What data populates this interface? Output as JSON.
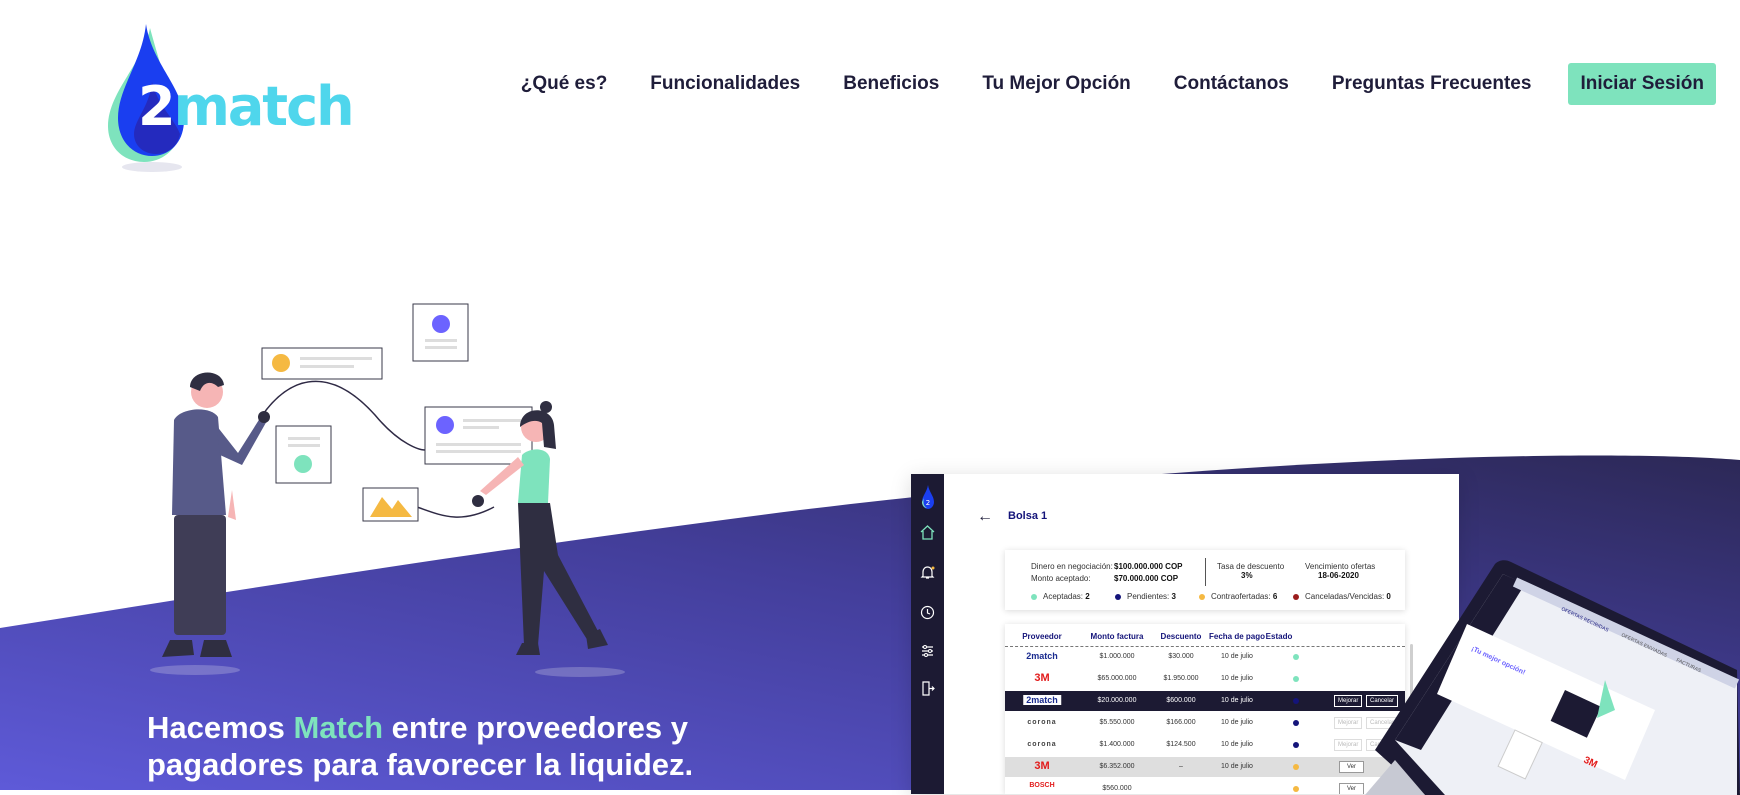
{
  "brand": {
    "logo_two": "2",
    "logo_rest": "match"
  },
  "nav": {
    "items": [
      {
        "label": "¿Qué es?"
      },
      {
        "label": "Funcionalidades"
      },
      {
        "label": "Beneficios"
      },
      {
        "label": "Tu Mejor Opción"
      },
      {
        "label": "Contáctanos"
      },
      {
        "label": "Preguntas Frecuentes"
      }
    ],
    "login_label": "Iniciar Sesión"
  },
  "hero": {
    "line1_a": "Hacemos ",
    "line1_highlight": "Match",
    "line1_b": " entre proveedores y",
    "line2": "pagadores para favorecer la liquidez."
  },
  "mockup": {
    "title": "Bolsa 1",
    "summary": {
      "money_label": "Dinero en negociación:",
      "money_value": "$100.000.000 COP",
      "accepted_label": "Monto aceptado:",
      "accepted_value": "$70.000.000 COP",
      "rate_label": "Tasa de descuento",
      "rate_value": "3%",
      "expiry_label": "Vencimiento ofertas",
      "expiry_value": "18-06-2020",
      "status": [
        {
          "label": "Aceptadas:",
          "count": "2",
          "color": "#7ee3bd"
        },
        {
          "label": "Pendientes:",
          "count": "3",
          "color": "#14147a"
        },
        {
          "label": "Contraofertadas:",
          "count": "6",
          "color": "#f5b942"
        },
        {
          "label": "Canceladas/Vencidas:",
          "count": "0",
          "color": "#9b1d1d"
        }
      ]
    },
    "table": {
      "headers": [
        "Proveedor",
        "Monto factura",
        "Descuento",
        "Fecha de pago",
        "Estado"
      ],
      "rows": [
        {
          "provider": "2match",
          "amount": "$1.000.000",
          "discount": "$30.000",
          "date": "10 de julio",
          "status_color": "#7ee3bd"
        },
        {
          "provider": "3M",
          "amount": "$65.000.000",
          "discount": "$1.950.000",
          "date": "10 de julio",
          "status_color": "#7ee3bd"
        },
        {
          "provider": "2match",
          "amount": "$20.000.000",
          "discount": "$600.000",
          "date": "10 de julio",
          "status_color": "#14147a",
          "btn1": "Mejorar",
          "btn2": "Cancelar"
        },
        {
          "provider": "corona",
          "amount": "$5.550.000",
          "discount": "$166.000",
          "date": "10 de julio",
          "status_color": "#14147a",
          "btn1": "Mejorar",
          "btn2": "Cancelar"
        },
        {
          "provider": "corona",
          "amount": "$1.400.000",
          "discount": "$124.500",
          "date": "10 de julio",
          "status_color": "#14147a",
          "btn1": "Mejorar",
          "btn2": "Cancelar"
        },
        {
          "provider": "3M",
          "amount": "$6.352.000",
          "discount": "–",
          "date": "10 de julio",
          "status_color": "#f5b942",
          "btn1": "Ver"
        },
        {
          "provider": "BOSCH",
          "amount": "$560.000",
          "discount": "",
          "date": "",
          "status_color": "#f5b942",
          "btn1": "Ver"
        }
      ]
    }
  },
  "laptop": {
    "tabs": [
      "OFERTAS RECIBIDAS",
      "OFERTAS ENVIADAS",
      "FACTURAS"
    ],
    "best_option": "¡Tu mejor opción!"
  },
  "colors": {
    "accent": "#7ee3bd",
    "navy": "#1c1a33",
    "purple": "#5a56cf",
    "dark_purple": "#2f2a5e",
    "logo_blue": "#1a3ef0",
    "logo_cyan": "#4fd6ec"
  }
}
